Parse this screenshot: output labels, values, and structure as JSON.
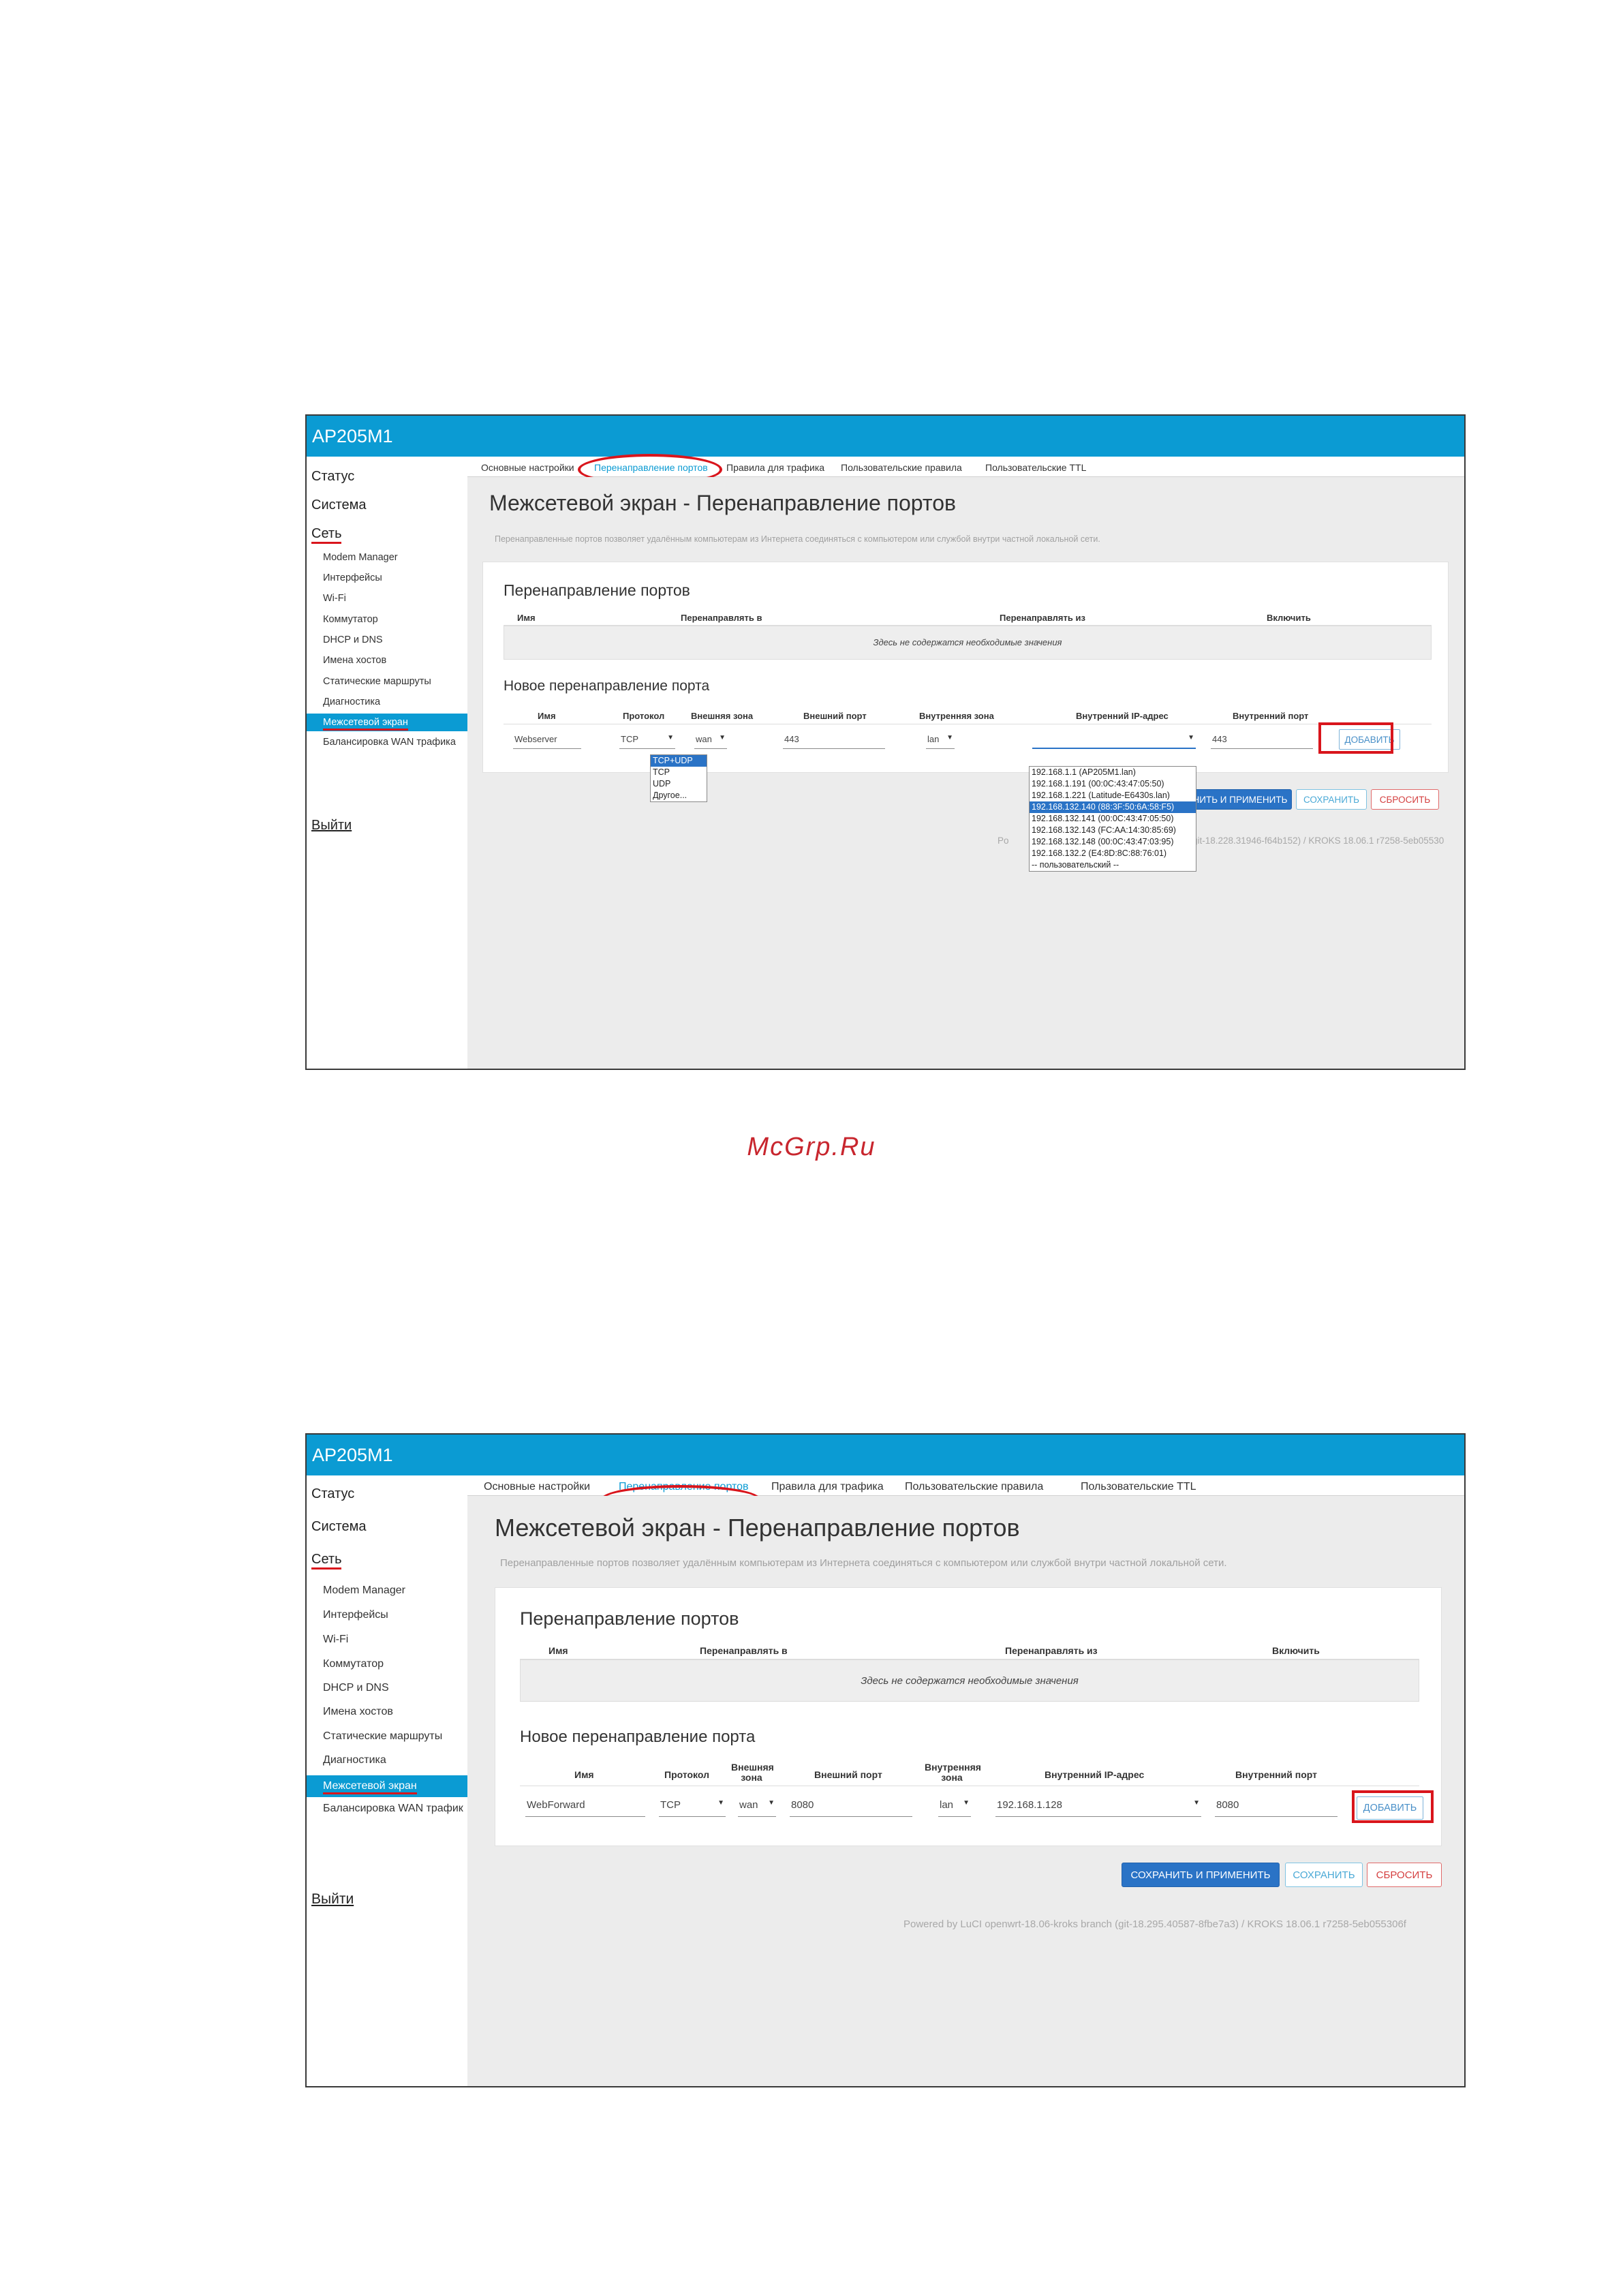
{
  "brand": "McGrp.Ru",
  "screens": [
    {
      "app_title": "AP205M1",
      "sidebar": {
        "top": [
          "Статус",
          "Система",
          "Сеть"
        ],
        "sub": [
          "Modem Manager",
          "Интерфейсы",
          "Wi-Fi",
          "Коммутатор",
          "DHCP и DNS",
          "Имена хостов",
          "Статические маршруты",
          "Диагностика",
          "Межсетевой экран",
          "Балансировка WAN трафика"
        ],
        "active_index": 8,
        "logout": "Выйти"
      },
      "tabs": [
        "Основные настройки",
        "Перенаправление портов",
        "Правила для трафика",
        "Пользовательские правила",
        "Пользовательские TTL"
      ],
      "active_tab": 1,
      "page_title": "Межсетевой экран - Перенаправление портов",
      "description": "Перенаправленные портов позволяет удалённым компьютерам из Интернета соединяться с компьютером или службой внутри частной локальной сети.",
      "section_title": "Перенаправление портов",
      "table_headers": [
        "Имя",
        "Перенаправлять в",
        "Перенаправлять из",
        "Включить"
      ],
      "empty_message": "Здесь не содержатся необходимые значения",
      "new_section_title": "Новое перенаправление порта",
      "form_headers": [
        "Имя",
        "Протокол",
        "Внешняя зона",
        "Внешний порт",
        "Внутренняя зона",
        "Внутренний IP-адрес",
        "Внутренний порт"
      ],
      "form_values": {
        "name": "Webserver",
        "protocol": "TCP",
        "ext_zone": "wan",
        "ext_port": "443",
        "int_zone": "lan",
        "int_ip": "",
        "int_port": "443"
      },
      "protocol_options": [
        "TCP+UDP",
        "TCP",
        "UDP",
        "Другое..."
      ],
      "protocol_highlighted": 0,
      "ip_options": [
        "192.168.1.1 (AP205M1.lan)",
        "192.168.1.191 (00:0C:43:47:05:50)",
        "192.168.1.221 (Latitude-E6430s.lan)",
        "192.168.132.140 (88:3F:50:6A:58:F5)",
        "192.168.132.141 (00:0C:43:47:05:50)",
        "192.168.132.143 (FC:AA:14:30:85:69)",
        "192.168.132.148 (00:0C:43:47:03:95)",
        "192.168.132.2 (E4:8D:8C:88:76:01)",
        "-- пользовательский --"
      ],
      "ip_highlighted": 3,
      "add_button": "ДОБАВИТЬ",
      "apply_button": "НИТЬ И ПРИМЕНИТЬ",
      "save_button": "СОХРАНИТЬ",
      "reset_button": "СБРОСИТЬ",
      "footer_left": "Po",
      "footer_right": "git-18.228.31946-f64b152) / KROKS 18.06.1 r7258-5eb05530"
    },
    {
      "app_title": "AP205M1",
      "sidebar": {
        "top": [
          "Статус",
          "Система",
          "Сеть"
        ],
        "sub": [
          "Modem Manager",
          "Интерфейсы",
          "Wi-Fi",
          "Коммутатор",
          "DHCP и DNS",
          "Имена хостов",
          "Статические маршруты",
          "Диагностика",
          "Межсетевой экран",
          "Балансировка WAN трафик"
        ],
        "active_index": 8,
        "logout": "Выйти"
      },
      "tabs": [
        "Основные настройки",
        "Перенаправление портов",
        "Правила для трафика",
        "Пользовательские правила",
        "Пользовательские TTL"
      ],
      "active_tab": 1,
      "page_title": "Межсетевой экран - Перенаправление портов",
      "description": "Перенаправленные портов позволяет удалённым компьютерам из Интернета соединяться с компьютером или службой внутри частной локальной сети.",
      "section_title": "Перенаправление портов",
      "table_headers": [
        "Имя",
        "Перенаправлять в",
        "Перенаправлять из",
        "Включить"
      ],
      "empty_message": "Здесь не содержатся необходимые значения",
      "new_section_title": "Новое перенаправление порта",
      "form_headers": [
        "Имя",
        "Протокол",
        "Внешняя зона",
        "Внешний порт",
        "Внутренняя зона",
        "Внутренний IP-адрес",
        "Внутренний порт"
      ],
      "form_values": {
        "name": "WebForward",
        "protocol": "TCP",
        "ext_zone": "wan",
        "ext_port": "8080",
        "int_zone": "lan",
        "int_ip": "192.168.1.128",
        "int_port": "8080"
      },
      "add_button": "ДОБАВИТЬ",
      "apply_button": "СОХРАНИТЬ И ПРИМЕНИТЬ",
      "save_button": "СОХРАНИТЬ",
      "reset_button": "СБРОСИТЬ",
      "footer": "Powered by LuCI openwrt-18.06-kroks branch (git-18.295.40587-8fbe7a3) / KROKS 18.06.1 r7258-5eb055306f"
    }
  ]
}
